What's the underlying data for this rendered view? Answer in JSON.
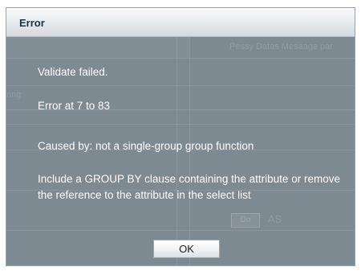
{
  "dialog": {
    "title": "Error",
    "messages": {
      "validate": "Validate failed.",
      "error_at": "Error at 7 to 83",
      "caused_by": "Caused by: not a single-group group function",
      "hint": "Include a GROUP BY clause containing the attribute or remove the reference to the attribute in the select list"
    },
    "ok_label": "OK"
  },
  "background": {
    "top_right_text": "Pessy Datas Mesaage par",
    "left_edge_text": "ring",
    "button_label": "Do",
    "as_text": "AS"
  },
  "colors": {
    "overlay": "#7d8a92",
    "titlebar": "#e6eaed",
    "title_text": "#1f2f3a",
    "message_text": "#ffffff"
  }
}
